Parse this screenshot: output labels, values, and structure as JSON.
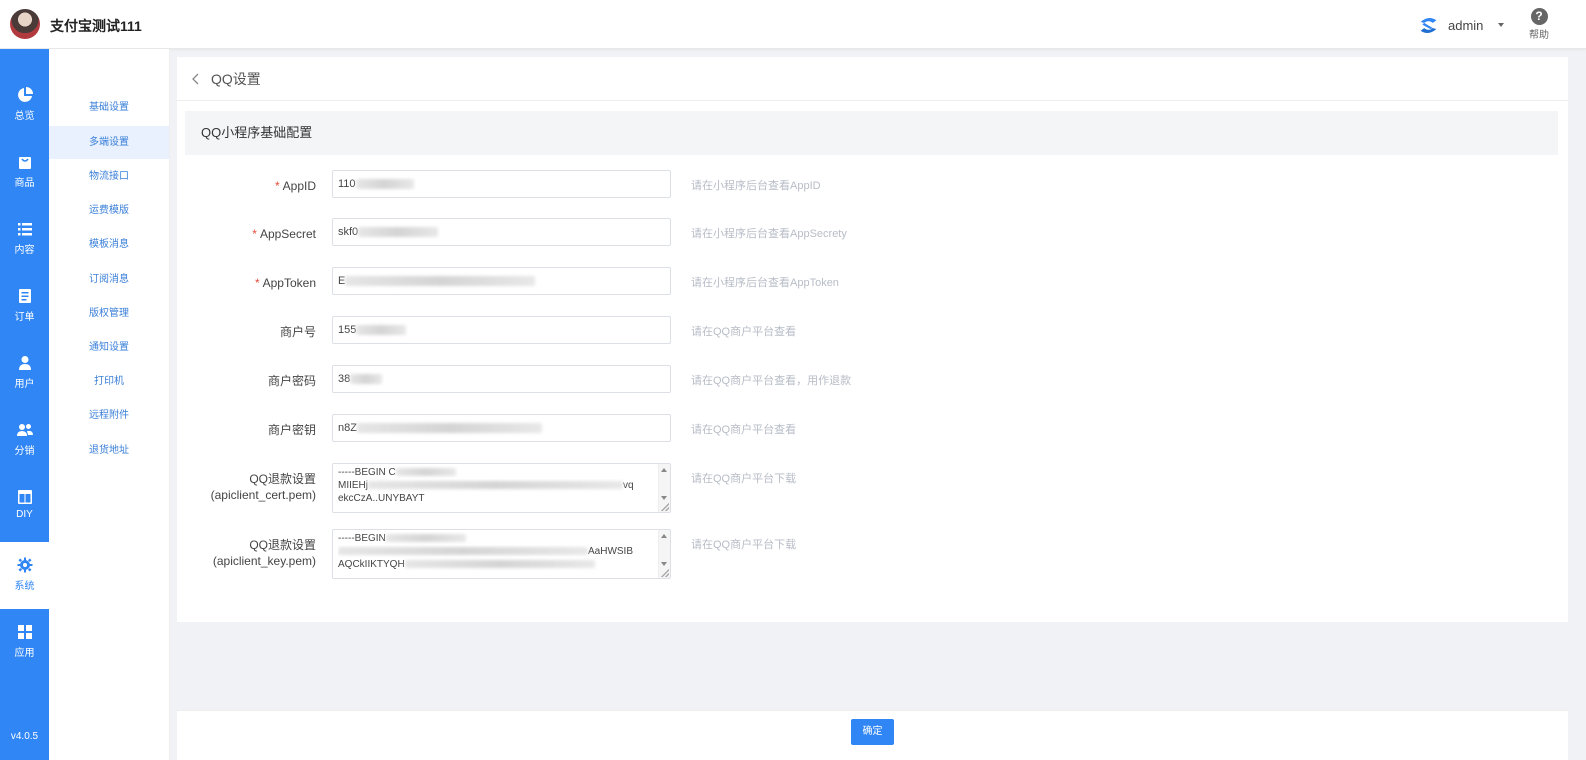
{
  "header": {
    "brand": "支付宝测试111",
    "user": "admin",
    "help_label": "帮助"
  },
  "leftnav": {
    "items": [
      {
        "label": "总览",
        "icon": "pie-chart-icon"
      },
      {
        "label": "商品",
        "icon": "shopping-bag-icon"
      },
      {
        "label": "内容",
        "icon": "list-icon"
      },
      {
        "label": "订单",
        "icon": "order-document-icon"
      },
      {
        "label": "用户",
        "icon": "user-icon"
      },
      {
        "label": "分销",
        "icon": "users-icon"
      },
      {
        "label": "DIY",
        "icon": "layout-icon"
      },
      {
        "label": "系统",
        "icon": "gear-icon"
      },
      {
        "label": "应用",
        "icon": "grid-icon"
      }
    ],
    "active": "系统",
    "version": "v4.0.5"
  },
  "subnav": {
    "items": [
      "基础设置",
      "多端设置",
      "物流接口",
      "运费模版",
      "模板消息",
      "订阅消息",
      "版权管理",
      "通知设置",
      "打印机",
      "远程附件",
      "退货地址"
    ],
    "active": "多端设置"
  },
  "page": {
    "title": "QQ设置",
    "section_title": "QQ小程序基础配置"
  },
  "form": {
    "appid": {
      "label": "AppID",
      "value": "110",
      "help": "请在小程序后台查看AppID",
      "required": true
    },
    "appsecret": {
      "label": "AppSecret",
      "value": "skf0",
      "help": "请在小程序后台查看AppSecrety",
      "required": true
    },
    "apptoken": {
      "label": "AppToken",
      "value": "E",
      "help": "请在小程序后台查看AppToken",
      "required": true
    },
    "mch_id": {
      "label": "商户号",
      "value": "155",
      "help": "请在QQ商户平台查看",
      "required": false
    },
    "mch_password": {
      "label": "商户密码",
      "value": "38",
      "help": "请在QQ商户平台查看，用作退款",
      "required": false
    },
    "mch_key": {
      "label": "商户密钥",
      "value": "n8Z",
      "help": "请在QQ商户平台查看",
      "required": false
    },
    "cert_pem": {
      "label_line1": "QQ退款设置",
      "label_line2": "(apiclient_cert.pem)",
      "lines": [
        "-----BEGIN C",
        "MIIEHj",
        "ekcCzA..UNYBAYT"
      ],
      "line2_tail": "vq",
      "help": "请在QQ商户平台下载"
    },
    "key_pem": {
      "label_line1": "QQ退款设置",
      "label_line2": "(apiclient_key.pem)",
      "lines": [
        "-----BEGIN",
        "",
        "AQCkIIKTYQH"
      ],
      "line2_tail": "AaHWSIB",
      "help": "请在QQ商户平台下载"
    }
  },
  "footer": {
    "confirm_label": "确定"
  },
  "colors": {
    "primary": "#2f86f4",
    "required": "#e74c3c",
    "help_text": "#b7bcc6"
  }
}
